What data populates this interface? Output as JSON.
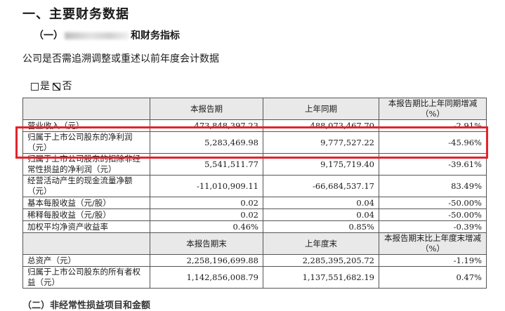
{
  "section_title": "一、主要财务数据",
  "subsection": {
    "prefix": "（一）",
    "suffix": "和财务指标"
  },
  "question": "公司是否需追溯调整或重述以前年度会计数据",
  "options": {
    "yes": "是",
    "no": "否"
  },
  "table": {
    "header1": [
      "",
      "本报告期",
      "上年同期",
      "本报告期比上年同期增减（%）"
    ],
    "rows1": [
      [
        "营业收入（元）",
        "473,848,397.23",
        "488,073,467.70",
        "-2.91%"
      ],
      [
        "归属于上市公司股东的净利润（元）",
        "5,283,469.98",
        "9,777,527.22",
        "-45.96%"
      ],
      [
        "归属于上市公司股东的扣除非经常性损益的净利润（元）",
        "5,541,511.77",
        "9,175,719.40",
        "-39.61%"
      ],
      [
        "经营活动产生的现金流量净额（元）",
        "-11,010,909.11",
        "-66,684,537.17",
        "83.49%"
      ],
      [
        "基本每股收益（元/股）",
        "0.02",
        "0.04",
        "-50.00%"
      ],
      [
        "稀释每股收益（元/股）",
        "0.02",
        "0.04",
        "-50.00%"
      ],
      [
        "加权平均净资产收益率",
        "0.46%",
        "0.85%",
        "-0.39%"
      ]
    ],
    "header2": [
      "",
      "本报告期末",
      "上年度末",
      "本报告期末比上年度末增减（%）"
    ],
    "rows2": [
      [
        "总资产（元）",
        "2,258,196,699.88",
        "2,285,395,205.72",
        "-1.19%"
      ],
      [
        "归属于上市公司股东的所有者权益（元）",
        "1,142,856,008.79",
        "1,137,551,682.19",
        "0.47%"
      ]
    ]
  },
  "next_heading_cut": "（二）非经常性损益项目和金额"
}
